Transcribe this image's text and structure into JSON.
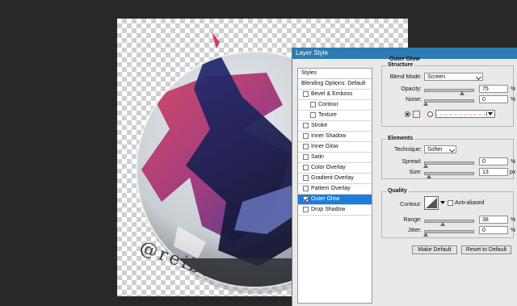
{
  "canvas": {
    "watermark": "@reiban"
  },
  "dialog": {
    "title": "Layer Style",
    "styles_header": "Styles",
    "blending_options": "Blending Options: Default",
    "items": [
      {
        "label": "Bevel & Emboss",
        "checked": false,
        "indent": false,
        "active": false
      },
      {
        "label": "Contour",
        "checked": false,
        "indent": true,
        "active": false
      },
      {
        "label": "Texture",
        "checked": false,
        "indent": true,
        "active": false
      },
      {
        "label": "Stroke",
        "checked": false,
        "indent": false,
        "active": false
      },
      {
        "label": "Inner Shadow",
        "checked": false,
        "indent": false,
        "active": false
      },
      {
        "label": "Inner Glow",
        "checked": false,
        "indent": false,
        "active": false
      },
      {
        "label": "Satin",
        "checked": false,
        "indent": false,
        "active": false
      },
      {
        "label": "Color Overlay",
        "checked": false,
        "indent": false,
        "active": false
      },
      {
        "label": "Gradient Overlay",
        "checked": false,
        "indent": false,
        "active": false
      },
      {
        "label": "Pattern Overlay",
        "checked": false,
        "indent": false,
        "active": false
      },
      {
        "label": "Outer Glow",
        "checked": true,
        "indent": false,
        "active": true
      },
      {
        "label": "Drop Shadow",
        "checked": false,
        "indent": false,
        "active": false
      }
    ],
    "outer_glow": {
      "title": "Outer Glow",
      "structure": {
        "title": "Structure",
        "blend_mode_label": "Blend Mode:",
        "blend_mode": "Screen",
        "opacity_label": "Opacity:",
        "opacity": "75",
        "opacity_level": 0.75,
        "noise_label": "Noise:",
        "noise": "0",
        "noise_level": 0,
        "percent": "%",
        "glow_color": "#ffe6f0"
      },
      "elements": {
        "title": "Elements",
        "technique_label": "Technique:",
        "technique": "Softer",
        "spread_label": "Spread:",
        "spread": "0",
        "spread_level": 0,
        "size_label": "Size:",
        "size": "13",
        "size_level": 0.07,
        "percent": "%",
        "px": "px"
      },
      "quality": {
        "title": "Quality",
        "contour_label": "Contour:",
        "anti_aliased_label": "Anti-aliased",
        "range_label": "Range:",
        "range": "38",
        "range_level": 0.38,
        "jitter_label": "Jitter:",
        "jitter": "0",
        "jitter_level": 0,
        "percent": "%"
      },
      "make_default": "Make Default",
      "reset_to_default": "Reset to Default"
    }
  }
}
